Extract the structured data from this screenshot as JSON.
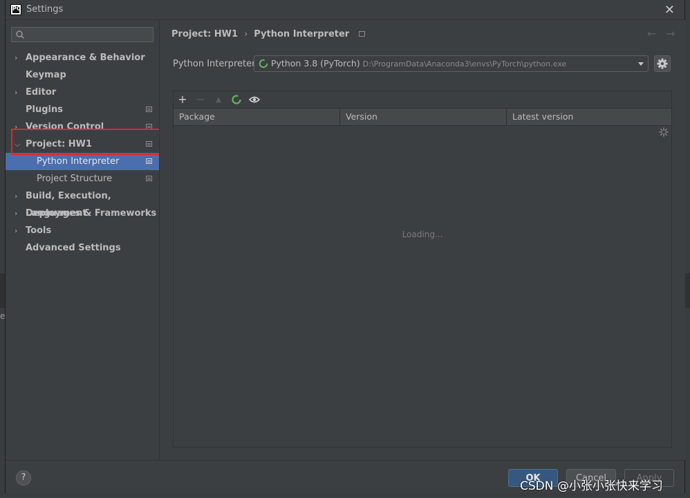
{
  "window": {
    "title": "Settings"
  },
  "backdrop": {
    "side_text": "ec"
  },
  "sidebar": {
    "search_placeholder": "",
    "items": [
      {
        "label": "Appearance & Behavior",
        "has_arrow": true,
        "expanded": false
      },
      {
        "label": "Keymap",
        "has_arrow": false
      },
      {
        "label": "Editor",
        "has_arrow": true,
        "expanded": false
      },
      {
        "label": "Plugins",
        "has_arrow": false,
        "project_icon": true
      },
      {
        "label": "Version Control",
        "has_arrow": true,
        "expanded": false,
        "project_icon": true
      },
      {
        "label": "Project: HW1",
        "has_arrow": true,
        "expanded": true,
        "project_icon": true
      },
      {
        "label": "Python Interpreter",
        "child": true,
        "selected": true,
        "project_icon": true
      },
      {
        "label": "Project Structure",
        "child": true,
        "project_icon": true
      },
      {
        "label": "Build, Execution, Deployment",
        "has_arrow": true,
        "expanded": false
      },
      {
        "label": "Languages & Frameworks",
        "has_arrow": true,
        "expanded": false
      },
      {
        "label": "Tools",
        "has_arrow": true,
        "expanded": false
      },
      {
        "label": "Advanced Settings",
        "has_arrow": false
      }
    ]
  },
  "breadcrumb": {
    "project": "Project: HW1",
    "separator": "›",
    "page": "Python Interpreter"
  },
  "interpreter": {
    "label": "Python Interpreter:",
    "name": "Python 3.8 (PyTorch)",
    "path": "D:\\ProgramData\\Anaconda3\\envs\\PyTorch\\python.exe"
  },
  "packages": {
    "columns": [
      "Package",
      "Version",
      "Latest version"
    ],
    "status": "Loading..."
  },
  "footer": {
    "help": "?",
    "ok": "OK",
    "cancel": "Cancel",
    "apply": "Apply"
  },
  "watermark": "CSDN @小张小张快来学习",
  "colors": {
    "selection": "#4b6eaf",
    "highlight_box": "#e5252a",
    "ok_button": "#365880",
    "spinner": "#5fb85f"
  }
}
